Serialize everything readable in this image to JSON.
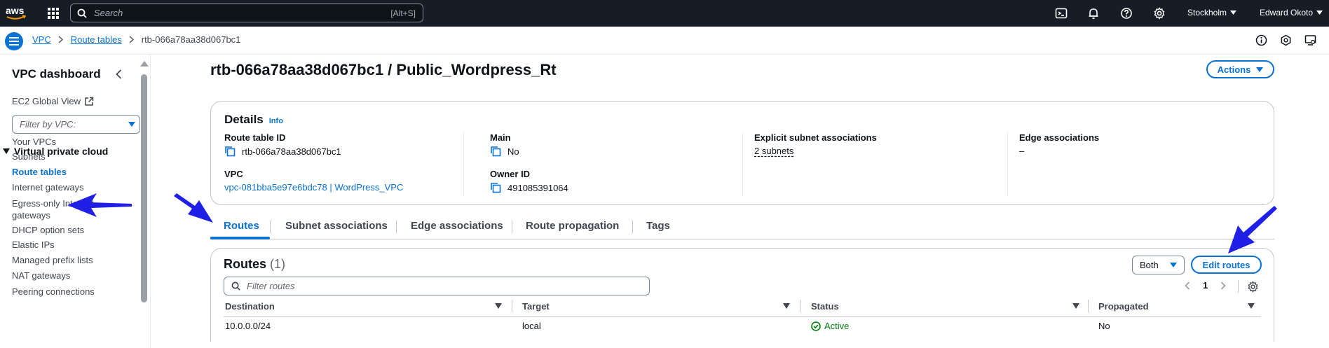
{
  "topnav": {
    "search_placeholder": "Search",
    "search_shortcut": "[Alt+S]",
    "region": "Stockholm",
    "user": "Edward Okoto"
  },
  "breadcrumb": {
    "items": [
      "VPC",
      "Route tables"
    ],
    "current": "rtb-066a78aa38d067bc1"
  },
  "sidebar": {
    "title": "VPC dashboard",
    "ec2_global_view": "EC2 Global View",
    "filter_placeholder": "Filter by VPC:",
    "section": "Virtual private cloud",
    "items": [
      {
        "label": "Your VPCs"
      },
      {
        "label": "Subnets"
      },
      {
        "label": "Route tables"
      },
      {
        "label": "Internet gateways"
      },
      {
        "label": "Egress-only Internet gateways"
      },
      {
        "label": "DHCP option sets"
      },
      {
        "label": "Elastic IPs"
      },
      {
        "label": "Managed prefix lists"
      },
      {
        "label": "NAT gateways"
      },
      {
        "label": "Peering connections"
      }
    ]
  },
  "page": {
    "title": "rtb-066a78aa38d067bc1 / Public_Wordpress_Rt",
    "actions_label": "Actions"
  },
  "details": {
    "heading": "Details",
    "info": "Info",
    "route_table_id_label": "Route table ID",
    "route_table_id": "rtb-066a78aa38d067bc1",
    "vpc_label": "VPC",
    "vpc_value": "vpc-081bba5e97e6bdc78 | WordPress_VPC",
    "main_label": "Main",
    "main_value": "No",
    "owner_label": "Owner ID",
    "owner_value": "491085391064",
    "explicit_label": "Explicit subnet associations",
    "explicit_value": "2 subnets",
    "edge_label": "Edge associations",
    "edge_value": "–"
  },
  "tabs": [
    "Routes",
    "Subnet associations",
    "Edge associations",
    "Route propagation",
    "Tags"
  ],
  "routes": {
    "title": "Routes",
    "count": "(1)",
    "both_label": "Both",
    "edit_label": "Edit routes",
    "filter_placeholder": "Filter routes",
    "page": "1",
    "columns": [
      "Destination",
      "Target",
      "Status",
      "Propagated"
    ],
    "rows": [
      {
        "destination": "10.0.0.0/24",
        "target": "local",
        "status": "Active",
        "propagated": "No"
      }
    ]
  },
  "colors": {
    "accent": "#0972d3",
    "topnav_bg": "#161d26",
    "active_status": "#037f0c",
    "annotation_arrow": "#1f1fe6"
  }
}
